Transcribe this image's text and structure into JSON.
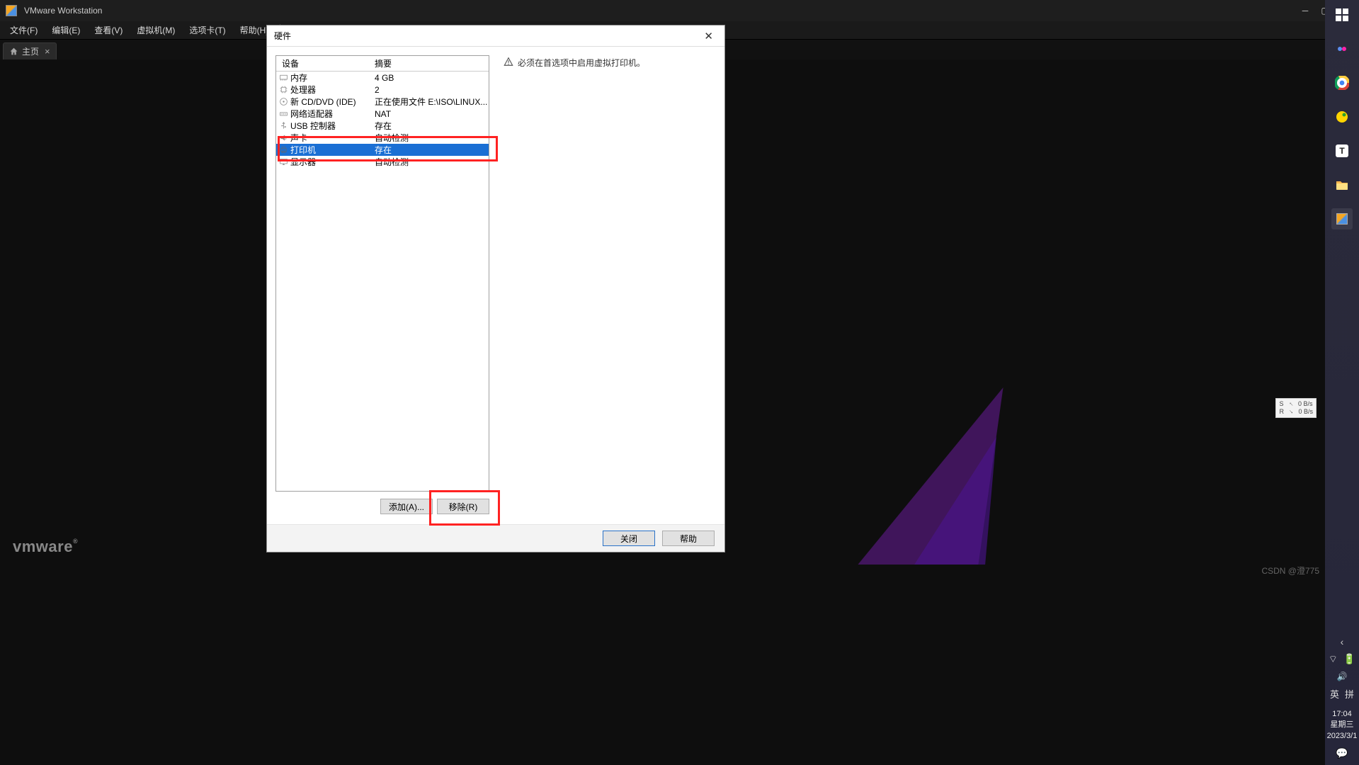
{
  "titlebar": {
    "app_name": "VMware Workstation"
  },
  "menubar": {
    "file": "文件(F)",
    "edit": "编辑(E)",
    "view": "查看(V)",
    "vm": "虚拟机(M)",
    "tabs": "选项卡(T)",
    "help": "帮助(H)"
  },
  "tab": {
    "home": "主页"
  },
  "dialog": {
    "title": "硬件",
    "col_device": "设备",
    "col_summary": "摘要",
    "devices": [
      {
        "name": "内存",
        "summary": "4 GB",
        "icon": "memory"
      },
      {
        "name": "处理器",
        "summary": "2",
        "icon": "cpu"
      },
      {
        "name": "新 CD/DVD (IDE)",
        "summary": "正在使用文件 E:\\ISO\\LINUX...",
        "icon": "disc"
      },
      {
        "name": "网络适配器",
        "summary": "NAT",
        "icon": "net"
      },
      {
        "name": "USB 控制器",
        "summary": "存在",
        "icon": "usb"
      },
      {
        "name": "声卡",
        "summary": "自动检测",
        "icon": "sound"
      },
      {
        "name": "打印机",
        "summary": "存在",
        "icon": "printer",
        "selected": true
      },
      {
        "name": "显示器",
        "summary": "自动检测",
        "icon": "display"
      }
    ],
    "add": "添加(A)...",
    "remove": "移除(R)",
    "warning": "必须在首选项中启用虚拟打印机。",
    "close": "关闭",
    "help": "帮助"
  },
  "logo": "vmware",
  "netstat": {
    "s": "S",
    "r": "R",
    "sv": "0 B/s",
    "rv": "0 B/s"
  },
  "ime": {
    "lang": "英",
    "mode": "拼"
  },
  "clock": {
    "time": "17:04",
    "weekday": "星期三",
    "date": "2023/3/1"
  },
  "watermark": "CSDN @澄775"
}
